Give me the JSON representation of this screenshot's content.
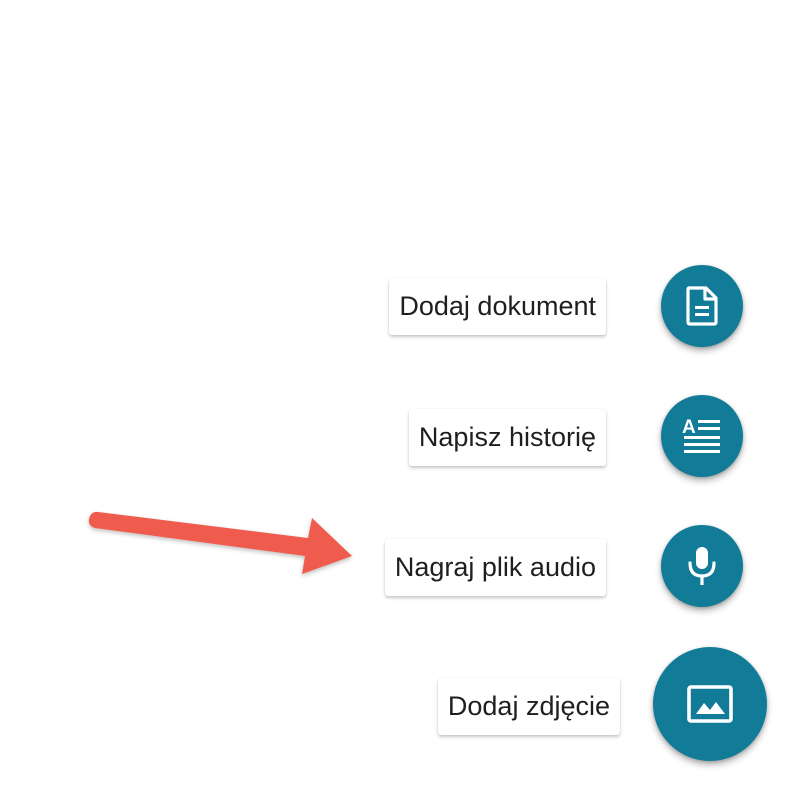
{
  "theme": {
    "fab_color": "#127b98",
    "icon_color": "#ffffff",
    "arrow_color": "#ef5b4d"
  },
  "menu": {
    "items": [
      {
        "id": "document",
        "label": "Dodaj dokument",
        "icon": "document-icon"
      },
      {
        "id": "story",
        "label": "Napisz historię",
        "icon": "text-article-icon"
      },
      {
        "id": "audio",
        "label": "Nagraj plik audio",
        "icon": "microphone-icon"
      },
      {
        "id": "photo",
        "label": "Dodaj zdjęcie",
        "icon": "image-icon"
      }
    ]
  },
  "annotation": {
    "arrow_icon": "arrow-right-icon",
    "points_to": "Nagraj plik audio"
  }
}
